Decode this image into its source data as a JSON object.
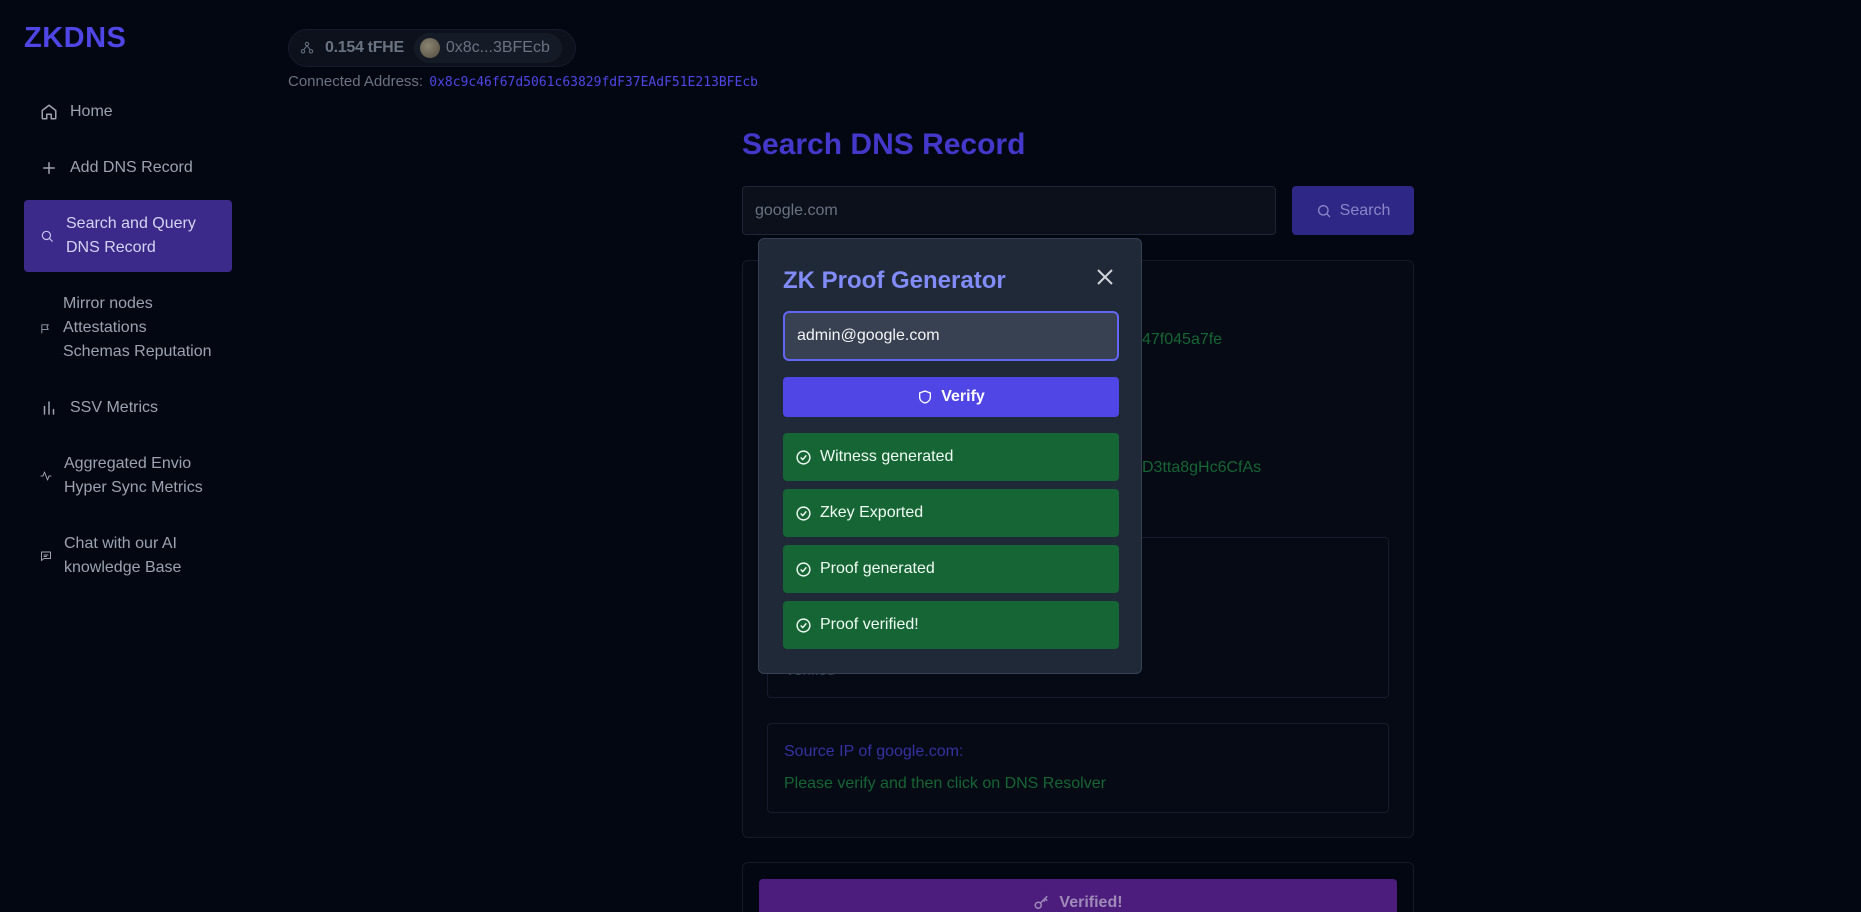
{
  "app": {
    "brand": "ZKDNS"
  },
  "sidebar": {
    "items": [
      {
        "label": "Home",
        "icon": "home-icon"
      },
      {
        "label": "Add DNS Record",
        "icon": "plus-icon"
      },
      {
        "label": "Search and Query DNS Record",
        "icon": "search-icon",
        "active": true
      },
      {
        "label": "Mirror nodes Attestations Schemas Reputation",
        "icon": "flag-icon"
      },
      {
        "label": "SSV Metrics",
        "icon": "bar-chart-icon"
      },
      {
        "label": "Aggregated Envio Hyper Sync Metrics",
        "icon": "activity-icon"
      },
      {
        "label": "Chat with our AI knowledge Base",
        "icon": "message-icon"
      }
    ]
  },
  "header": {
    "balance": "0.154 tFHE",
    "short_address": "0x8c...3BFEcb",
    "connected_label": "Connected Address:",
    "connected_address": "0x8c9c46f67d5061c63829fdF37EAdF51E213BFEcb"
  },
  "main": {
    "title": "Search DNS Record",
    "search_value": "google.com",
    "search_button": "Search",
    "partial_hash_1": "47f045a7fe",
    "partial_hash_2": "D3tta8gHc6CfAs",
    "faded_text": "Verified",
    "source_label": "Source IP of google.com:",
    "source_message": "Please verify and then click on DNS Resolver",
    "verified_button": "Verified!"
  },
  "modal": {
    "title": "ZK Proof Generator",
    "input_value": "admin@google.com",
    "verify_button": "Verify",
    "steps": [
      "Witness generated",
      "Zkey Exported",
      "Proof generated",
      "Proof verified!"
    ]
  },
  "colors": {
    "background": "#030712",
    "accent": "#4f46e5",
    "success": "#166534",
    "active_nav": "#3b2a8a",
    "verified": "#4c1d7c"
  }
}
